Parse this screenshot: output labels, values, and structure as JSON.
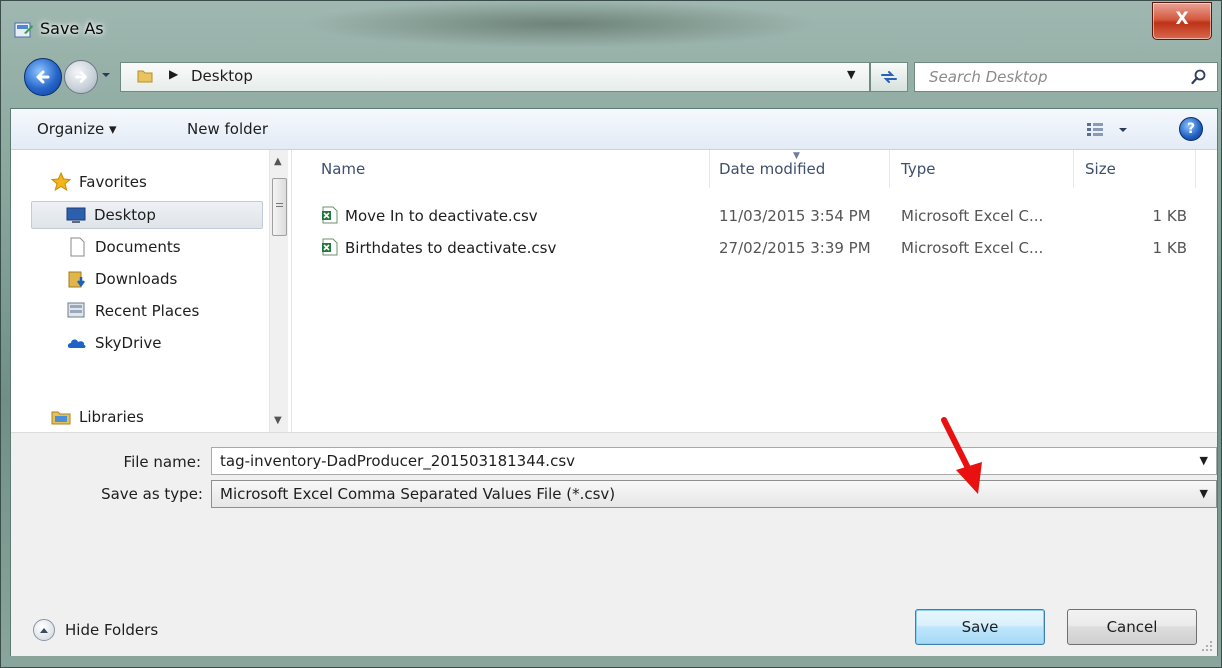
{
  "window": {
    "title": "Save As",
    "close_label": "X"
  },
  "address": {
    "location": "Desktop",
    "search_placeholder": "Search Desktop"
  },
  "toolbar": {
    "organize": "Organize ▾",
    "new_folder": "New folder",
    "help": "?"
  },
  "sidebar": {
    "items": [
      {
        "label": "Favorites",
        "icon": "star-icon"
      },
      {
        "label": "Desktop",
        "icon": "desktop-icon",
        "selected": true
      },
      {
        "label": "Documents",
        "icon": "document-icon"
      },
      {
        "label": "Downloads",
        "icon": "downloads-icon"
      },
      {
        "label": "Recent Places",
        "icon": "recent-places-icon"
      },
      {
        "label": "SkyDrive",
        "icon": "skydrive-icon"
      },
      {
        "label": "Libraries",
        "icon": "libraries-icon"
      }
    ]
  },
  "filelist": {
    "columns": [
      "Name",
      "Date modified",
      "Type",
      "Size"
    ],
    "rows": [
      {
        "name": "Move In to deactivate.csv",
        "date": "11/03/2015 3:54 PM",
        "type": "Microsoft Excel C...",
        "size": "1 KB"
      },
      {
        "name": "Birthdates to deactivate.csv",
        "date": "27/02/2015 3:39 PM",
        "type": "Microsoft Excel C...",
        "size": "1 KB"
      }
    ]
  },
  "form": {
    "file_name_label": "File name:",
    "file_name_value": "tag-inventory-DadProducer_201503181344.csv",
    "save_type_label": "Save as type:",
    "save_type_value": "Microsoft Excel Comma Separated Values File (*.csv)"
  },
  "footer": {
    "hide_folders": "Hide Folders",
    "save": "Save",
    "cancel": "Cancel"
  },
  "colors": {
    "annotation_arrow": "#e8110f",
    "default_button": "#bee6fd"
  }
}
